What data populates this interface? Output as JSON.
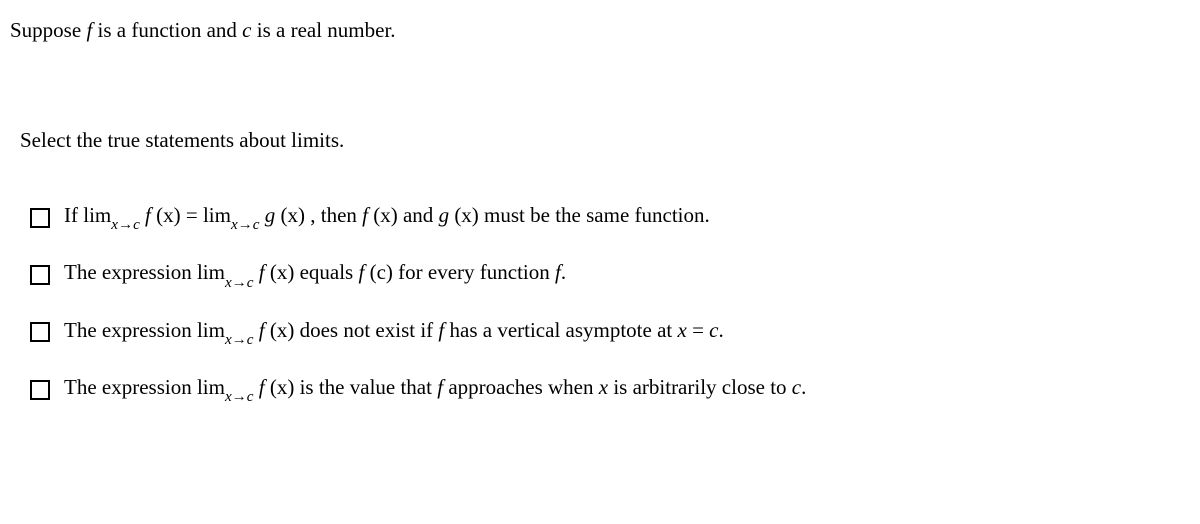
{
  "intro": {
    "pre": "Suppose ",
    "f": "f",
    "mid1": " is a function and ",
    "c": "c",
    "mid2": " is a real number."
  },
  "select_prompt": "Select the true statements about limits.",
  "options": {
    "opt1": {
      "p1": "If lim",
      "sub1": "x→c",
      "p2": " f",
      "p3": " (x) = lim",
      "sub2": "x→c",
      "p4": " g",
      "p5": " (x) ,  then ",
      "p6": " f",
      "p7": " (x) and ",
      "p8": "g",
      "p9": " (x) must be the same function."
    },
    "opt2": {
      "p1": "The expression lim",
      "sub1": "x→c",
      "p2": " f",
      "p3": " (x) equals ",
      "p4": " f",
      "p5": " (c) for every function ",
      "p6": " f",
      "p7": "."
    },
    "opt3": {
      "p1": "The expression lim",
      "sub1": "x→c",
      "p2": " f",
      "p3": " (x) does not exist if ",
      "p4": " f",
      "p5": " has a vertical asymptote at ",
      "p6": "x",
      "p7": " = ",
      "p8": "c",
      "p9": "."
    },
    "opt4": {
      "p1": "The expression lim",
      "sub1": "x→c",
      "p2": " f",
      "p3": " (x) is the value that ",
      "p4": " f",
      "p5": " approaches when ",
      "p6": "x",
      "p7": " is arbitrarily close to ",
      "p8": "c",
      "p9": "."
    }
  }
}
